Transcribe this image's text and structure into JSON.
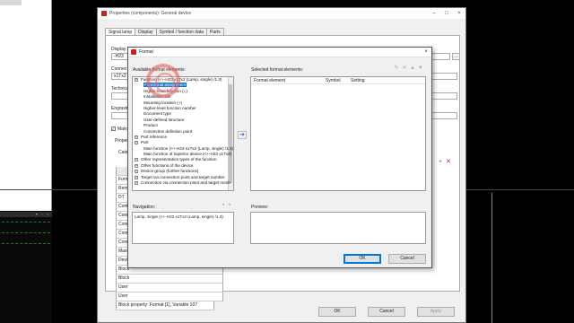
{
  "properties_window": {
    "title": "Properties (components): General device",
    "tabs": [
      "Signal lamp",
      "Display",
      "Symbol / function data",
      "Parts"
    ],
    "fields": {
      "displayed_label": "Display",
      "displayed_value": "-H23",
      "connect_label": "Connec",
      "connect_value": "x1Tx2",
      "technical_label": "Technica",
      "engraving_label": "Engravin",
      "main_check_label": "Main",
      "properties_label": "Propert",
      "category_label": "Categ"
    },
    "prop_rows": [
      "",
      "Form",
      "Rema",
      "DT ",
      "Cont",
      "Conn",
      "Conn",
      "Conn",
      "Conn",
      "Maxi",
      "Devi",
      "Block",
      "Block",
      "User",
      "User",
      "Block property: Format [1], Variable 107"
    ],
    "buttons": {
      "ok": "OK",
      "cancel": "Cancel",
      "apply": "Apply"
    }
  },
  "format_dialog": {
    "title": "Format",
    "available_label": "Available format elements:",
    "selected_label": "Selected format elements:",
    "available_items": [
      {
        "text": "Function (<+-H23 x1Tx2 (Lamp, single) /1.3)",
        "expander": "+",
        "selected": false
      },
      {
        "text": "Functional assignment",
        "expander": "",
        "selected": true
      },
      {
        "text": "Higher-level function (=)",
        "expander": "",
        "selected": false
      },
      {
        "text": "Installation site",
        "expander": "",
        "selected": false
      },
      {
        "text": "Mounting location (+)",
        "expander": "",
        "selected": false
      },
      {
        "text": "Higher-level function number",
        "expander": "",
        "selected": false
      },
      {
        "text": "Document type",
        "expander": "",
        "selected": false
      },
      {
        "text": "User-defined structure",
        "expander": "",
        "selected": false
      },
      {
        "text": "Product",
        "expander": "",
        "selected": false
      },
      {
        "text": "Connection definition point",
        "expander": "",
        "selected": false
      },
      {
        "text": "Part reference",
        "expander": "+",
        "selected": false
      },
      {
        "text": "Part",
        "expander": "+",
        "selected": false
      },
      {
        "text": "Main function (<+-H23 x1Tx2 (Lamp, single) /1.3)",
        "expander": "",
        "selected": false
      },
      {
        "text": "Main function of superior device (<+-H23 x1Tx2)",
        "expander": "",
        "selected": false
      },
      {
        "text": "Other representation types of the function",
        "expander": "+",
        "selected": false
      },
      {
        "text": "Other functions of the device",
        "expander": "+",
        "selected": false
      },
      {
        "text": "Device group (further functions)",
        "expander": "+",
        "selected": false
      },
      {
        "text": "Target via connection point and target number",
        "expander": "+",
        "selected": false
      },
      {
        "text": "Connection via connection point and target numb",
        "expander": "+",
        "selected": false
      }
    ],
    "columns": [
      "Format element",
      "Symbol",
      "Setting"
    ],
    "navigation_label": "Navigation:",
    "navigation_value": "Lamp, single (<+-H23 x1Tx2 (Lamp, single) /1.3)",
    "preview_label": "Preview:",
    "buttons": {
      "ok": "OK",
      "cancel": "Cancel"
    }
  },
  "colors": {
    "selection": "#0078d7",
    "accent_red": "#c8201e"
  }
}
